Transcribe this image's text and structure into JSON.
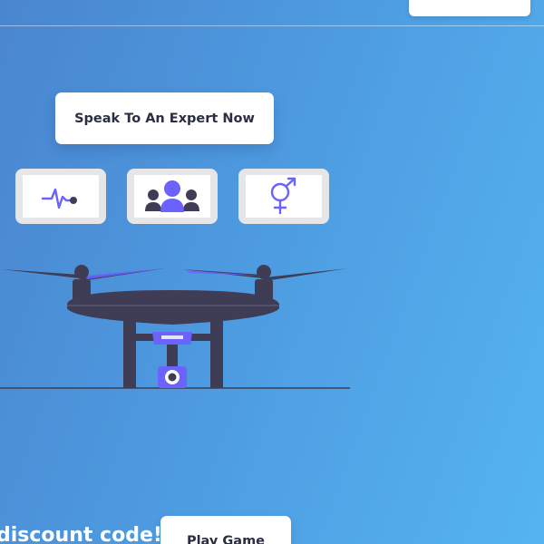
{
  "header": {
    "top_right_button_label": ""
  },
  "cta": {
    "expert_label": "Speak To An Expert Now"
  },
  "icon_cards": [
    {
      "icon": "heartbeat-icon"
    },
    {
      "icon": "group-users-icon"
    },
    {
      "icon": "gender-symbol-icon"
    }
  ],
  "illustration": {
    "subject": "drone-illustration"
  },
  "promo": {
    "text": "discount code!",
    "play_label": "Play Game"
  },
  "colors": {
    "background_start": "#4a86cf",
    "background_end": "#55b4f1",
    "accent": "#6c63ff",
    "dark": "#3f3d56"
  }
}
